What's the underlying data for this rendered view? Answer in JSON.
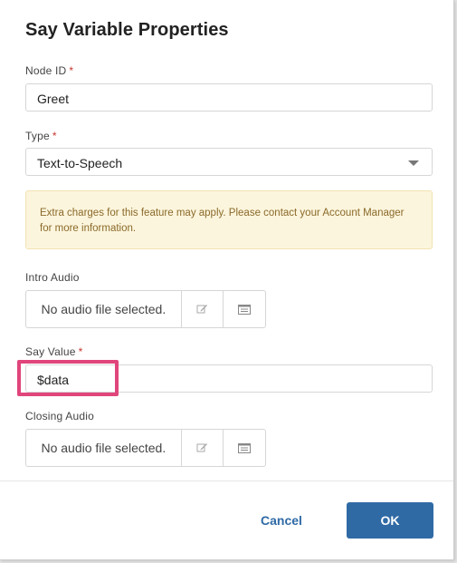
{
  "dialog": {
    "title": "Say Variable Properties"
  },
  "node_id": {
    "label": "Node ID",
    "required_mark": "*",
    "value": "Greet"
  },
  "type": {
    "label": "Type",
    "required_mark": "*",
    "selected": "Text-to-Speech"
  },
  "notice": {
    "text": "Extra charges for this feature may apply. Please contact your Account Manager for more information."
  },
  "intro_audio": {
    "label": "Intro Audio",
    "status": "No audio file selected."
  },
  "say_value": {
    "label": "Say Value",
    "required_mark": "*",
    "value": "$data"
  },
  "closing_audio": {
    "label": "Closing Audio",
    "status": "No audio file selected."
  },
  "footer": {
    "cancel_label": "Cancel",
    "ok_label": "OK"
  },
  "colors": {
    "primary": "#2f6aa5",
    "required": "#c8372d",
    "notice_bg": "#fcf5dd",
    "highlight": "#e0457b"
  },
  "icons": {
    "edit": "pencil-edit-icon",
    "browse": "list-browse-icon",
    "dropdown": "chevron-down-icon"
  }
}
